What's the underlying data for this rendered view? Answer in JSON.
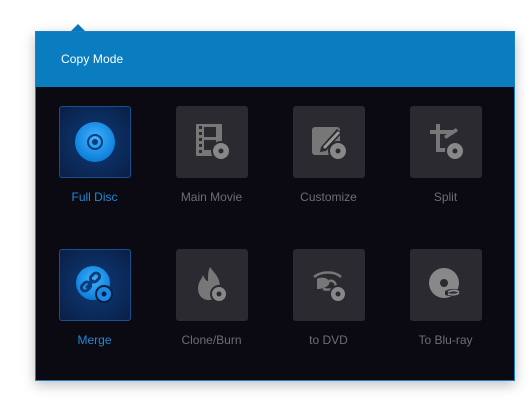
{
  "popup": {
    "title": "Copy Mode",
    "accent_color": "#0a7cc0",
    "active_label_color": "#1e8ad6",
    "modes": [
      {
        "label": "Full Disc",
        "icon": "disc-icon",
        "active": true
      },
      {
        "label": "Main Movie",
        "icon": "film-disc-icon",
        "active": false
      },
      {
        "label": "Customize",
        "icon": "edit-pen-disc-icon",
        "active": false
      },
      {
        "label": "Split",
        "icon": "crop-disc-icon",
        "active": false
      },
      {
        "label": "Merge",
        "icon": "link-disc-icon",
        "active": true
      },
      {
        "label": "Clone/Burn",
        "icon": "flame-disc-icon",
        "active": false
      },
      {
        "label": "to DVD",
        "icon": "bluray-to-dvd-icon",
        "active": false
      },
      {
        "label": "To Blu-ray",
        "icon": "dvd-to-bluray-icon",
        "active": false
      }
    ]
  }
}
